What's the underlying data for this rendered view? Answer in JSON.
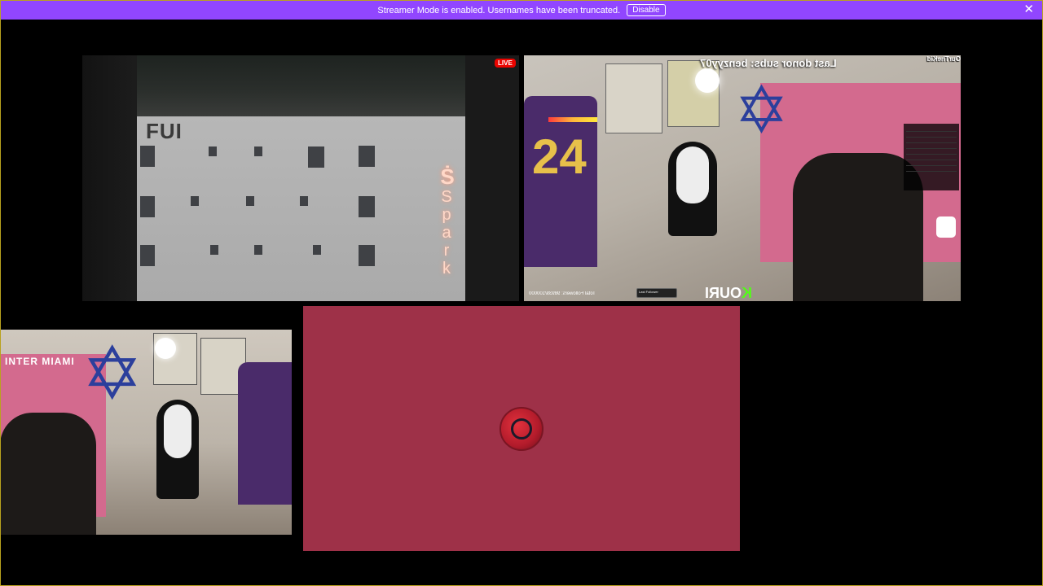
{
  "banner": {
    "message": "Streamer Mode is enabled. Usernames have been truncated.",
    "button": "Disable",
    "close_glyph": "✕",
    "color": "#9146ff"
  },
  "tiles": {
    "building": {
      "live_badge": "LIVE",
      "wall_text": "FUI",
      "sign_logo": "Ṡ",
      "sign_text": "Spark"
    },
    "room_main": {
      "topic": "Last donor subs: benzyy07",
      "owner": "OurTheKid",
      "jersey_number": "24",
      "brand_prefix": "K",
      "brand_rest": "OURI",
      "followers": "Total Followers: 98939/100000",
      "last_follow": "Last Follower"
    },
    "room_secondary": {
      "poster_text": "INTER MIAMI"
    },
    "placeholder": {
      "background_color": "#9e3148"
    }
  }
}
